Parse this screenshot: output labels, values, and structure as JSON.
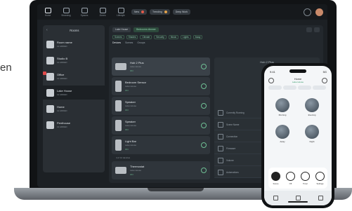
{
  "edge_text": "en",
  "topnav": {
    "items": [
      {
        "label": "Home",
        "icon": "home-icon"
      },
      {
        "label": "Browsing",
        "icon": "grid-icon"
      },
      {
        "label": "Spaces",
        "icon": "spaces-icon"
      },
      {
        "label": "Zones",
        "icon": "zone-icon"
      },
      {
        "label": "Lifestyle",
        "icon": "lifestyle-icon"
      }
    ],
    "pills": [
      "New",
      "Trending",
      "Deep Work"
    ]
  },
  "sidebar": {
    "title": "Rooms",
    "rooms": [
      {
        "name": "Room name",
        "sub": "12 ADDED"
      },
      {
        "name": "Studio B",
        "sub": "12 ADDED"
      },
      {
        "name": "Office",
        "sub": "12 ADDED"
      },
      {
        "name": "Lake House",
        "sub": "12 ADDED"
      },
      {
        "name": "Home",
        "sub": "12 ADDED"
      },
      {
        "name": "Penthouse",
        "sub": "12 ADDED"
      }
    ]
  },
  "main": {
    "header_pills": [
      "Lake House",
      "Bedrooms dimmer"
    ],
    "chips": [
      "Scenes",
      "Shades",
      "Climate",
      "Security",
      "Music",
      "Lights",
      "Away"
    ],
    "tabs": [
      "Devices",
      "Scenes",
      "Groups"
    ],
    "devices": [
      {
        "name": "Hub 2 Plus",
        "sub": "Lake House",
        "meta": "ON"
      },
      {
        "name": "Bedroom Sensor",
        "sub": "Lake House",
        "meta": "ON"
      },
      {
        "name": "Speaker",
        "sub": "Lake House",
        "meta": "ON"
      },
      {
        "name": "Speaker",
        "sub": "Lake House",
        "meta": "ON"
      },
      {
        "name": "Light Bar",
        "sub": "Lake House",
        "meta": "ON"
      },
      {
        "name": "Thermostat",
        "sub": "Lake House",
        "meta": "ON"
      }
    ],
    "list_footnote": "4 of 12 devices",
    "detail_title": "Hub 2 Plus",
    "detail_rows": [
      "Currently Running",
      "Scene Name",
      "Connection",
      "Firmware",
      "Volume",
      "Automations"
    ]
  },
  "phone": {
    "time": "9:41",
    "signal": "5G",
    "title": "Home",
    "subtitle": "Lake House",
    "scenes": [
      "Morning",
      "Evening",
      "Away",
      "Night"
    ],
    "controls": [
      "Scene",
      "Off",
      "Timer",
      "Settings"
    ]
  }
}
